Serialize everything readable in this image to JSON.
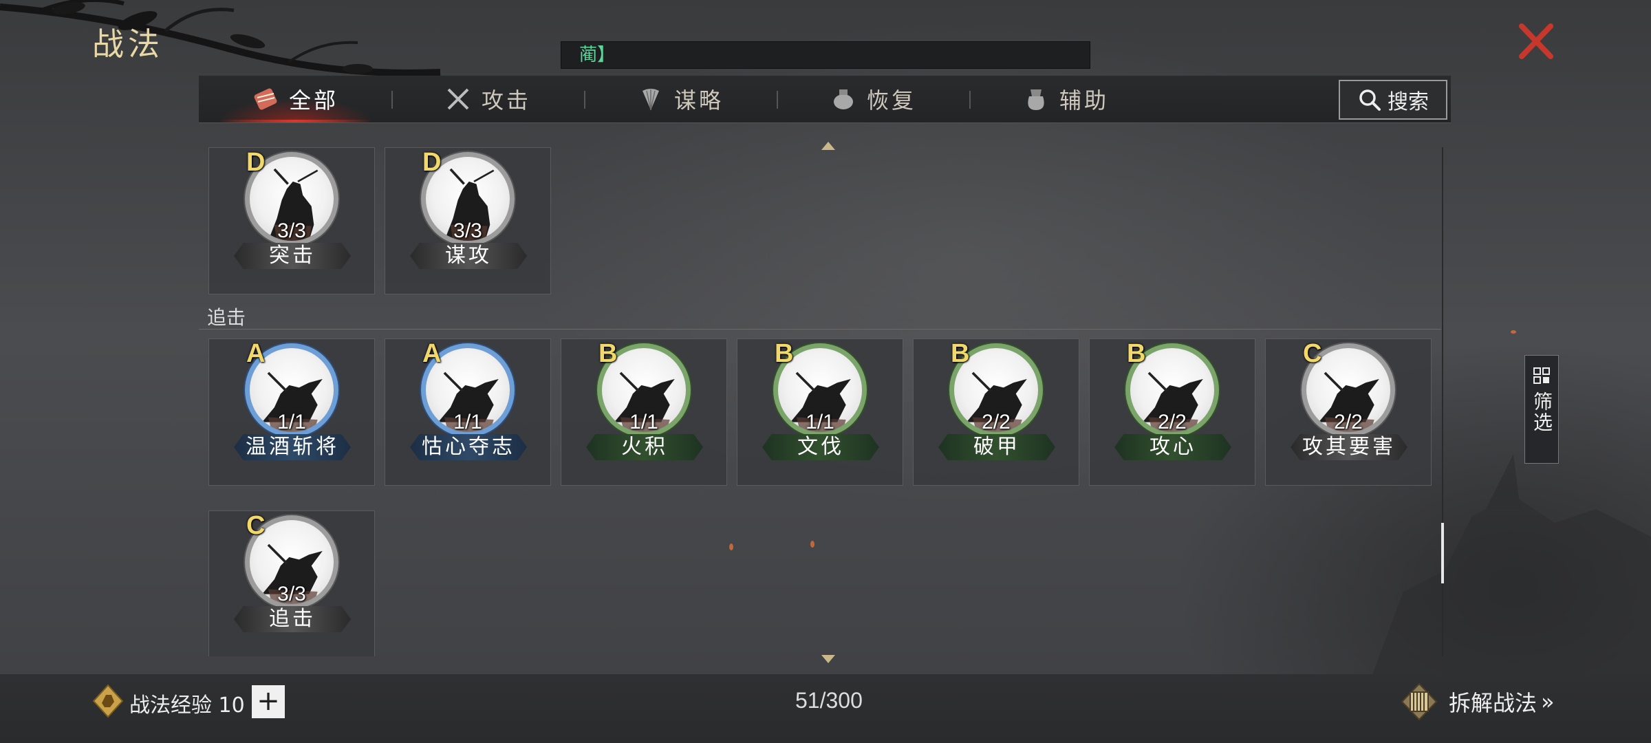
{
  "window": {
    "title": "战法"
  },
  "search": {
    "text": "蔺】"
  },
  "tabs": [
    {
      "label": "全部",
      "icon": "scroll-bundle-icon",
      "active": true
    },
    {
      "label": "攻击",
      "icon": "crossed-swords-icon",
      "active": false
    },
    {
      "label": "谋略",
      "icon": "feather-fan-icon",
      "active": false
    },
    {
      "label": "恢复",
      "icon": "medicine-pot-icon",
      "active": false
    },
    {
      "label": "辅助",
      "icon": "pouch-icon",
      "active": false
    }
  ],
  "search_button": {
    "label": "搜索"
  },
  "filter_button": {
    "label": "筛选"
  },
  "sections": [
    {
      "title": "",
      "cards": [
        {
          "grade": "D",
          "count": "3/3",
          "name": "突击"
        },
        {
          "grade": "D",
          "count": "3/3",
          "name": "谋攻"
        }
      ]
    },
    {
      "title": "追击",
      "cards": [
        {
          "grade": "A",
          "count": "1/1",
          "name": "温酒斩将"
        },
        {
          "grade": "A",
          "count": "1/1",
          "name": "怙心夺志"
        },
        {
          "grade": "B",
          "count": "1/1",
          "name": "火积"
        },
        {
          "grade": "B",
          "count": "1/1",
          "name": "文伐"
        },
        {
          "grade": "B",
          "count": "2/2",
          "name": "破甲"
        },
        {
          "grade": "B",
          "count": "2/2",
          "name": "攻心"
        },
        {
          "grade": "C",
          "count": "2/2",
          "name": "攻其要害"
        },
        {
          "grade": "C",
          "count": "3/3",
          "name": "追击"
        }
      ]
    }
  ],
  "footer": {
    "exp_label": "战法经验 10",
    "plus_label": "+",
    "capacity": "51/300",
    "dismantle_label": "拆解战法",
    "dismantle_chevron": "»"
  },
  "colors": {
    "accent_red": "#d8392a",
    "grade_gold": "#f2d86a",
    "rank_A": "#6e9ed6",
    "rank_B": "#7aa46a",
    "rank_C": "#9c9c9c"
  }
}
